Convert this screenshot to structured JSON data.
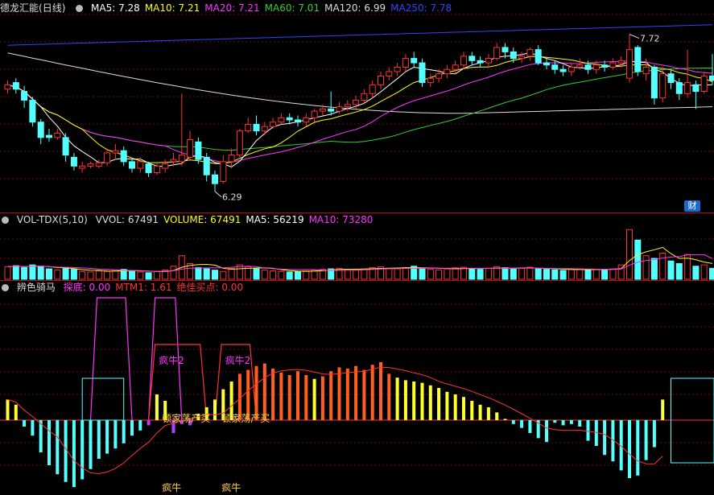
{
  "main_panel": {
    "stock_name": "德龙汇能",
    "period": "(日线)",
    "ma_labels": [
      {
        "text": "MA5: 7.28",
        "color": "#ffffff"
      },
      {
        "text": "MA10: 7.21",
        "color": "#ffff00"
      },
      {
        "text": "MA20: 7.21",
        "color": "#ff33ff"
      },
      {
        "text": "MA60: 7.01",
        "color": "#33cc33"
      },
      {
        "text": "MA120: 6.99",
        "color": "#dddddd"
      },
      {
        "text": "MA250: 7.78",
        "color": "#3344ff"
      }
    ],
    "high_label": "7.72",
    "low_label": "6.29",
    "badge": "财"
  },
  "vol_panel": {
    "title": "VOL-TDX(5,10)",
    "labels": [
      {
        "text": "VVOL: 67491",
        "color": "#dddddd"
      },
      {
        "text": "VOLUME: 67491",
        "color": "#ffff00"
      },
      {
        "text": "MA5: 56219",
        "color": "#ffffff"
      },
      {
        "text": "MA10: 73280",
        "color": "#ff33ff"
      }
    ]
  },
  "ind_panel": {
    "title": "辨色骑马",
    "labels": [
      {
        "text": "探底: 0.00",
        "color": "#ff33ff"
      },
      {
        "text": "MTM1: 1.61",
        "color": "#ff3333"
      },
      {
        "text": "绝佳买点: 0.00",
        "color": "#ff3333"
      }
    ],
    "signal_top": "疯牛2",
    "signal_mid": "顿家荡产买",
    "signal_bottom": "疯牛"
  },
  "chart_data": {
    "type": "candlestick",
    "candles": [
      [
        7.22,
        7.26,
        7.3,
        7.18
      ],
      [
        7.28,
        7.22,
        7.32,
        7.18
      ],
      [
        7.2,
        7.12,
        7.25,
        7.05
      ],
      [
        7.12,
        6.92,
        7.15,
        6.88
      ],
      [
        6.92,
        6.78,
        6.95,
        6.72
      ],
      [
        6.8,
        6.78,
        6.86,
        6.74
      ],
      [
        6.78,
        6.82,
        6.86,
        6.76
      ],
      [
        6.78,
        6.62,
        6.82,
        6.56
      ],
      [
        6.6,
        6.52,
        6.64,
        6.48
      ],
      [
        6.5,
        6.52,
        6.56,
        6.46
      ],
      [
        6.52,
        6.54,
        6.56,
        6.5
      ],
      [
        6.52,
        6.55,
        6.58,
        6.5
      ],
      [
        6.55,
        6.64,
        6.68,
        6.52
      ],
      [
        6.64,
        6.66,
        6.72,
        6.58
      ],
      [
        6.66,
        6.56,
        6.7,
        6.52
      ],
      [
        6.56,
        6.5,
        6.58,
        6.46
      ],
      [
        6.5,
        6.56,
        6.6,
        6.46
      ],
      [
        6.54,
        6.46,
        6.56,
        6.42
      ],
      [
        6.46,
        6.52,
        6.56,
        6.44
      ],
      [
        6.5,
        6.54,
        6.58,
        6.46
      ],
      [
        6.56,
        6.58,
        6.64,
        6.52
      ],
      [
        6.56,
        6.62,
        7.18,
        6.52
      ],
      [
        6.6,
        6.76,
        6.84,
        6.58
      ],
      [
        6.74,
        6.58,
        6.78,
        6.54
      ],
      [
        6.6,
        6.44,
        6.64,
        6.38
      ],
      [
        6.44,
        6.36,
        6.48,
        6.29
      ],
      [
        6.38,
        6.56,
        6.62,
        6.36
      ],
      [
        6.56,
        6.62,
        6.68,
        6.5
      ],
      [
        6.62,
        6.84,
        6.86,
        6.6
      ],
      [
        6.84,
        6.9,
        6.96,
        6.82
      ],
      [
        6.9,
        6.84,
        6.98,
        6.8
      ],
      [
        6.84,
        6.88,
        6.92,
        6.8
      ],
      [
        6.88,
        6.92,
        6.96,
        6.86
      ],
      [
        6.92,
        6.96,
        7.0,
        6.9
      ],
      [
        6.96,
        6.94,
        7.0,
        6.9
      ],
      [
        6.94,
        6.92,
        6.98,
        6.88
      ],
      [
        6.92,
        6.96,
        7.0,
        6.88
      ],
      [
        6.96,
        7.02,
        7.04,
        6.92
      ],
      [
        7.02,
        7.04,
        7.08,
        6.98
      ],
      [
        7.04,
        7.02,
        7.2,
        6.98
      ],
      [
        7.02,
        7.06,
        7.1,
        7.0
      ],
      [
        7.06,
        7.08,
        7.12,
        7.02
      ],
      [
        7.08,
        7.12,
        7.16,
        7.04
      ],
      [
        7.12,
        7.18,
        7.22,
        7.08
      ],
      [
        7.18,
        7.26,
        7.3,
        7.14
      ],
      [
        7.26,
        7.34,
        7.38,
        7.22
      ],
      [
        7.34,
        7.38,
        7.42,
        7.3
      ],
      [
        7.38,
        7.42,
        7.46,
        7.34
      ],
      [
        7.42,
        7.5,
        7.54,
        7.38
      ],
      [
        7.5,
        7.46,
        7.56,
        7.42
      ],
      [
        7.46,
        7.28,
        7.5,
        7.24
      ],
      [
        7.28,
        7.32,
        7.36,
        7.24
      ],
      [
        7.32,
        7.36,
        7.4,
        7.28
      ],
      [
        7.36,
        7.4,
        7.44,
        7.32
      ],
      [
        7.4,
        7.44,
        7.48,
        7.36
      ],
      [
        7.44,
        7.52,
        7.56,
        7.4
      ],
      [
        7.52,
        7.48,
        7.56,
        7.44
      ],
      [
        7.48,
        7.46,
        7.52,
        7.42
      ],
      [
        7.46,
        7.5,
        7.54,
        7.42
      ],
      [
        7.5,
        7.6,
        7.64,
        7.48
      ],
      [
        7.6,
        7.56,
        7.64,
        7.5
      ],
      [
        7.56,
        7.5,
        7.6,
        7.46
      ],
      [
        7.5,
        7.52,
        7.56,
        7.46
      ],
      [
        7.52,
        7.58,
        7.6,
        7.48
      ],
      [
        7.58,
        7.46,
        7.62,
        7.44
      ],
      [
        7.46,
        7.44,
        7.5,
        7.4
      ],
      [
        7.44,
        7.4,
        7.48,
        7.36
      ],
      [
        7.4,
        7.38,
        7.44,
        7.34
      ],
      [
        7.38,
        7.42,
        7.46,
        7.34
      ],
      [
        7.42,
        7.44,
        7.5,
        7.4
      ],
      [
        7.44,
        7.4,
        7.48,
        7.36
      ],
      [
        7.4,
        7.44,
        7.48,
        7.36
      ],
      [
        7.44,
        7.42,
        7.48,
        7.38
      ],
      [
        7.42,
        7.46,
        7.5,
        7.4
      ],
      [
        7.46,
        7.48,
        7.52,
        7.42
      ],
      [
        7.32,
        7.58,
        7.72,
        7.28
      ],
      [
        7.6,
        7.38,
        7.62,
        7.34
      ],
      [
        7.36,
        7.42,
        7.5,
        7.3
      ],
      [
        7.42,
        7.14,
        7.44,
        7.08
      ],
      [
        7.14,
        7.36,
        7.42,
        7.1
      ],
      [
        7.36,
        7.28,
        7.4,
        7.22
      ],
      [
        7.28,
        7.18,
        7.32,
        7.12
      ],
      [
        7.18,
        7.28,
        7.58,
        7.14
      ],
      [
        7.26,
        7.2,
        7.3,
        7.04
      ],
      [
        7.2,
        7.34,
        7.38,
        7.18
      ],
      [
        7.34,
        7.3,
        7.54,
        7.26
      ]
    ],
    "ylim": [
      6.2,
      7.9
    ],
    "volume": [
      48,
      52,
      45,
      55,
      50,
      40,
      35,
      42,
      38,
      30,
      28,
      32,
      30,
      35,
      38,
      30,
      28,
      25,
      30,
      35,
      50,
      90,
      60,
      45,
      40,
      35,
      30,
      42,
      55,
      48,
      40,
      35,
      32,
      30,
      28,
      30,
      32,
      35,
      38,
      40,
      42,
      38,
      36,
      40,
      45,
      48,
      42,
      40,
      45,
      50,
      42,
      38,
      36,
      40,
      44,
      46,
      40,
      38,
      42,
      48,
      44,
      40,
      42,
      46,
      40,
      38,
      36,
      34,
      38,
      40,
      36,
      38,
      36,
      40,
      55,
      190,
      150,
      90,
      80,
      100,
      70,
      60,
      95,
      50,
      55,
      42
    ],
    "indicator": [
      1.6,
      1.2,
      -0.5,
      -1.2,
      -2.5,
      -3.5,
      -4.2,
      -4.8,
      -5.2,
      -4.6,
      -3.8,
      -3.0,
      -2.6,
      -2.2,
      -1.8,
      -1.2,
      -0.8,
      -0.4,
      2.0,
      1.5,
      -1.0,
      -0.3,
      -0.4,
      0.5,
      1.0,
      1.6,
      2.4,
      3.0,
      3.6,
      3.9,
      4.2,
      4.4,
      4.0,
      3.7,
      3.5,
      3.8,
      3.5,
      3.2,
      3.4,
      3.8,
      4.1,
      4.0,
      4.2,
      3.9,
      4.3,
      4.5,
      3.6,
      3.3,
      3.1,
      3.0,
      2.9,
      2.7,
      2.5,
      2.2,
      2.0,
      1.8,
      1.5,
      1.2,
      1.0,
      0.6,
      0.1,
      -0.3,
      -0.6,
      -1.0,
      -1.4,
      -1.7,
      -0.2,
      -0.4,
      -0.3,
      -0.5,
      -1.6,
      -2.0,
      -2.7,
      -3.2,
      -3.9,
      -4.5,
      -4.3,
      -3.1,
      -2.1,
      1.6
    ]
  }
}
